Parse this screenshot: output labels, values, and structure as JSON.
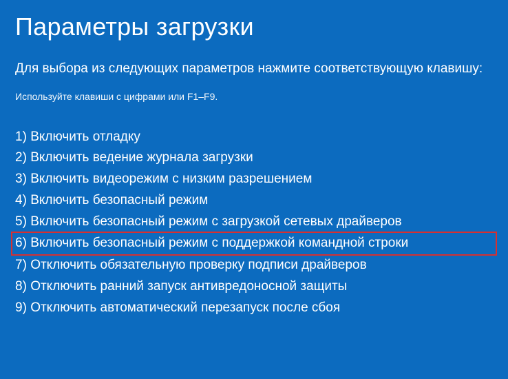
{
  "title": "Параметры загрузки",
  "subtitle": "Для выбора из следующих параметров нажмите соответствующую клавишу:",
  "hint": "Используйте клавиши с цифрами или F1–F9.",
  "options": [
    {
      "num": "1)",
      "label": "Включить отладку",
      "highlighted": false
    },
    {
      "num": "2)",
      "label": "Включить ведение журнала загрузки",
      "highlighted": false
    },
    {
      "num": "3)",
      "label": "Включить видеорежим с низким разрешением",
      "highlighted": false
    },
    {
      "num": "4)",
      "label": "Включить безопасный режим",
      "highlighted": false
    },
    {
      "num": "5)",
      "label": "Включить безопасный режим с загрузкой сетевых драйверов",
      "highlighted": false
    },
    {
      "num": "6)",
      "label": "Включить безопасный режим с поддержкой командной строки",
      "highlighted": true
    },
    {
      "num": "7)",
      "label": "Отключить обязательную проверку подписи драйверов",
      "highlighted": false
    },
    {
      "num": "8)",
      "label": "Отключить ранний запуск антивредоносной защиты",
      "highlighted": false
    },
    {
      "num": "9)",
      "label": "Отключить автоматический перезапуск после сбоя",
      "highlighted": false
    }
  ]
}
